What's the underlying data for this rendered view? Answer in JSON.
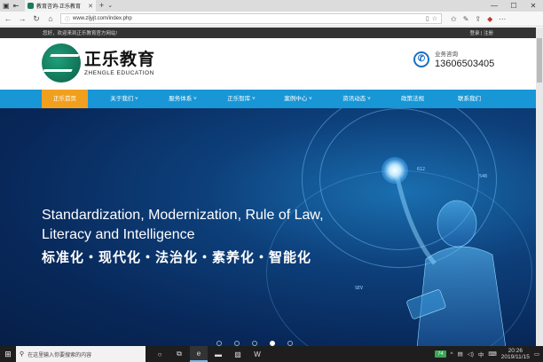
{
  "browser": {
    "tab_title": "教育咨询-正乐教育",
    "tab_close": "✕",
    "new_tab": "+",
    "tab_list": "⌄",
    "url": "www.zljyjt.com/index.php",
    "window": {
      "minimize": "—",
      "maximize": "☐",
      "close": "✕"
    }
  },
  "site": {
    "welcome": "您好，欢迎来到正乐教育官方网站!",
    "auth": "登录 | 注册",
    "logo_cn": "正乐教育",
    "logo_en": "ZHENGLE EDUCATION",
    "contact_label": "业务咨询",
    "contact_phone": "13606503405",
    "menu": [
      {
        "label": "正乐首页"
      },
      {
        "label": "关于我们 ˅"
      },
      {
        "label": "服务体系 ˅"
      },
      {
        "label": "正乐智库 ˅"
      },
      {
        "label": "案例中心 ˅"
      },
      {
        "label": "资讯动态 ˅"
      },
      {
        "label": "政策法规"
      },
      {
        "label": "联系我们"
      }
    ],
    "hero": {
      "line1": "Standardization, Modernization, Rule of Law,",
      "line2": "Literacy and Intelligence",
      "cn": "标准化・现代化・法治化・素养化・智能化",
      "slide_count": 5,
      "active_slide": 4
    }
  },
  "taskbar": {
    "search_placeholder": "在这里输入你要搜索的内容",
    "battery": "74",
    "ime": "中",
    "time": "20:26",
    "date": "2019/11/15"
  },
  "colors": {
    "menu_bg": "#1896d6",
    "menu_active": "#f0a01e",
    "topstrip": "#333333",
    "logo_green": "#1a7a5c"
  }
}
